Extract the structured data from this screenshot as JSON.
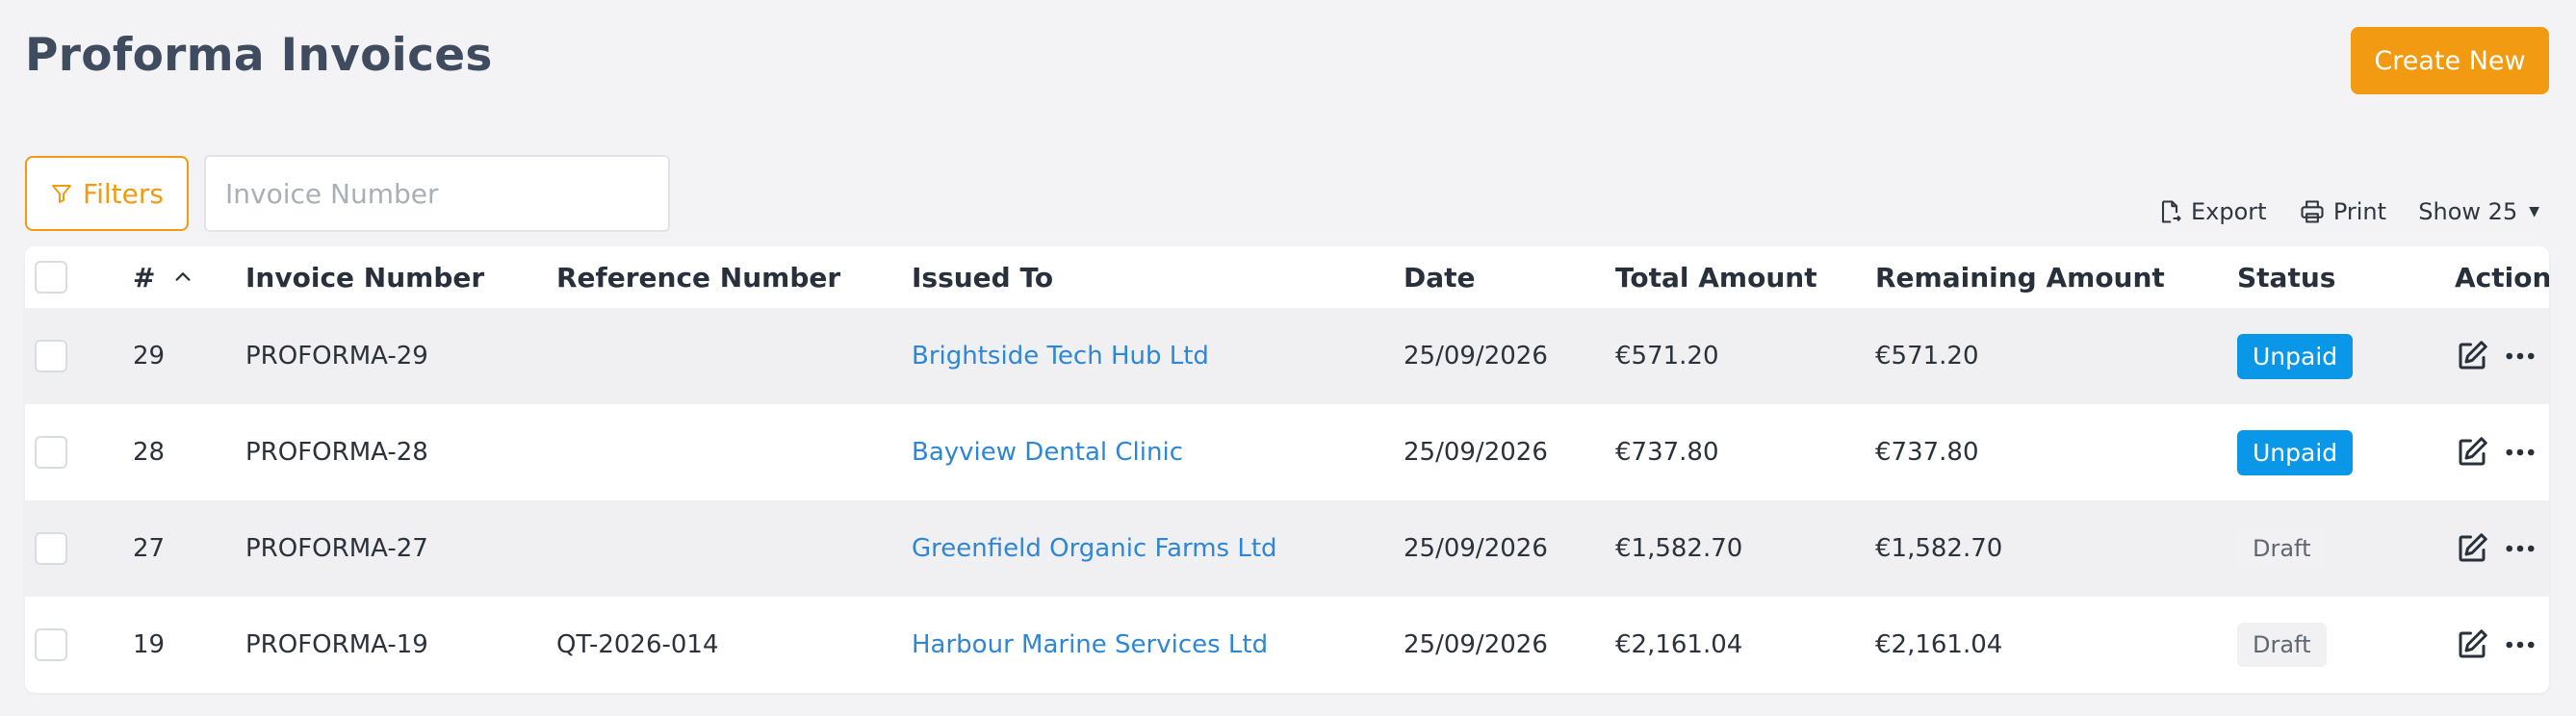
{
  "page": {
    "title": "Proforma Invoices",
    "create_label": "Create New"
  },
  "filters": {
    "label": "Filters",
    "search_placeholder": "Invoice Number",
    "search_value": ""
  },
  "toolbar": {
    "export_label": "Export",
    "print_label": "Print",
    "show_label": "Show 25"
  },
  "table": {
    "columns": {
      "num": "#",
      "invoice": "Invoice Number",
      "reference": "Reference Number",
      "issued": "Issued To",
      "date": "Date",
      "total": "Total Amount",
      "remaining": "Remaining Amount",
      "status": "Status",
      "action": "Action"
    },
    "rows": [
      {
        "num": "29",
        "invoice": "PROFORMA-29",
        "reference": "",
        "issued": "Brightside Tech Hub Ltd",
        "date": "25/09/2026",
        "total": "€571.20",
        "remaining": "€571.20",
        "status": "Unpaid"
      },
      {
        "num": "28",
        "invoice": "PROFORMA-28",
        "reference": "",
        "issued": "Bayview Dental Clinic",
        "date": "25/09/2026",
        "total": "€737.80",
        "remaining": "€737.80",
        "status": "Unpaid"
      },
      {
        "num": "27",
        "invoice": "PROFORMA-27",
        "reference": "",
        "issued": "Greenfield Organic Farms Ltd",
        "date": "25/09/2026",
        "total": "€1,582.70",
        "remaining": "€1,582.70",
        "status": "Draft"
      },
      {
        "num": "19",
        "invoice": "PROFORMA-19",
        "reference": "QT-2026-014",
        "issued": "Harbour Marine Services Ltd",
        "date": "25/09/2026",
        "total": "€2,161.04",
        "remaining": "€2,161.04",
        "status": "Draft"
      }
    ]
  },
  "colors": {
    "accent": "#f29a11",
    "link": "#2e86d6",
    "unpaid_badge": "#0b97e8",
    "draft_badge": "#f1f1f3"
  },
  "icons": [
    "filter-icon",
    "export-icon",
    "print-icon",
    "chevron-down-icon",
    "sort-up-icon",
    "edit-icon",
    "more-icon"
  ]
}
